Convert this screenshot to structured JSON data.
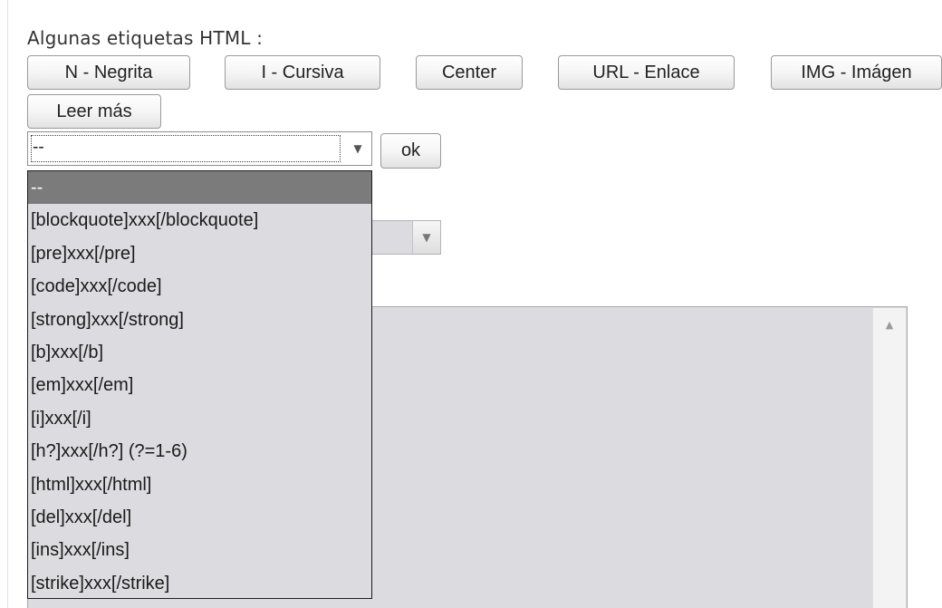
{
  "form": {
    "heading": "Algunas etiquetas HTML :",
    "toolbar": {
      "bold_label": "N - Negrita",
      "italic_label": "I - Cursiva",
      "center_label": "Center",
      "link_label": "URL - Enlace",
      "image_label": "IMG - Imágen",
      "readmore_label": "Leer más"
    },
    "tag_select": {
      "selected_value": "--",
      "ok_label": "ok",
      "options": [
        "--",
        "[blockquote]xxx[/blockquote]",
        "[pre]xxx[/pre]",
        "[code]xxx[/code]",
        "[strong]xxx[/strong]",
        "[b]xxx[/b]",
        "[em]xxx[/em]",
        "[i]xxx[/i]",
        "[h?]xxx[/h?] (?=1-6)",
        "[html]xxx[/html]",
        "[del]xxx[/del]",
        "[ins]xxx[/ins]",
        "[strike]xxx[/strike]"
      ],
      "highlighted_index": 0
    },
    "icons": {
      "select_arrow": "chevron-down-icon",
      "scroll_up": "arrow-up-icon"
    },
    "colors": {
      "highlight": "#7b7b7b",
      "field_background": "#dcdbe0"
    }
  }
}
